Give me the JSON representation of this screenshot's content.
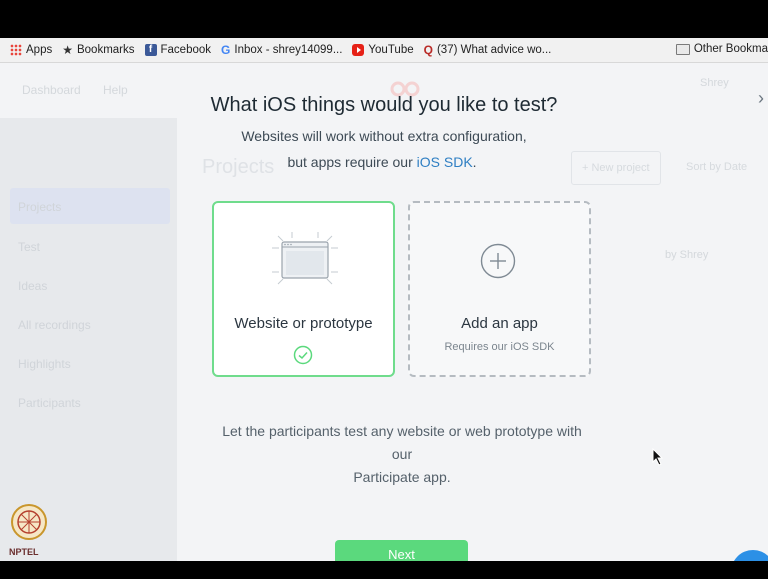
{
  "bookmarks": [
    {
      "label": "Apps",
      "icon": "apps-icon"
    },
    {
      "label": "Bookmarks",
      "icon": "star-icon"
    },
    {
      "label": "Facebook",
      "icon": "facebook-icon"
    },
    {
      "label": "Inbox - shrey14099...",
      "icon": "google-icon"
    },
    {
      "label": "YouTube",
      "icon": "youtube-icon"
    },
    {
      "label": "(37) What advice wo...",
      "icon": "quora-icon"
    }
  ],
  "bookmarks_more": "»",
  "other_bookmarks": "Other Bookma",
  "background": {
    "nav_dashboard": "Dashboard",
    "nav_help": "Help",
    "projects_title": "Projects",
    "new_project": "+ New project",
    "sort_by": "Sort by Date",
    "user_name": "Shrey",
    "sidebar": [
      "Projects",
      "Test",
      "Ideas",
      "All recordings",
      "Highlights",
      "Participants"
    ],
    "row_owner": "by Shrey"
  },
  "modal": {
    "title": "What iOS things would you like to test?",
    "subtitle_line1": "Websites will work without extra configuration,",
    "subtitle_line2_prefix": "but apps require our ",
    "subtitle_link": "iOS SDK",
    "subtitle_line2_suffix": ".",
    "option_website": "Website or prototype",
    "option_app": "Add an app",
    "option_app_sub": "Requires our iOS SDK",
    "description_line1": "Let the participants test any website or web prototype with our",
    "description_line2": "Participate app.",
    "next_button": "Next"
  },
  "watermark": "NPTEL",
  "colors": {
    "accent_green": "#5bd97d",
    "link_blue": "#2f7fc3",
    "selected_border": "#6fdc8c"
  }
}
